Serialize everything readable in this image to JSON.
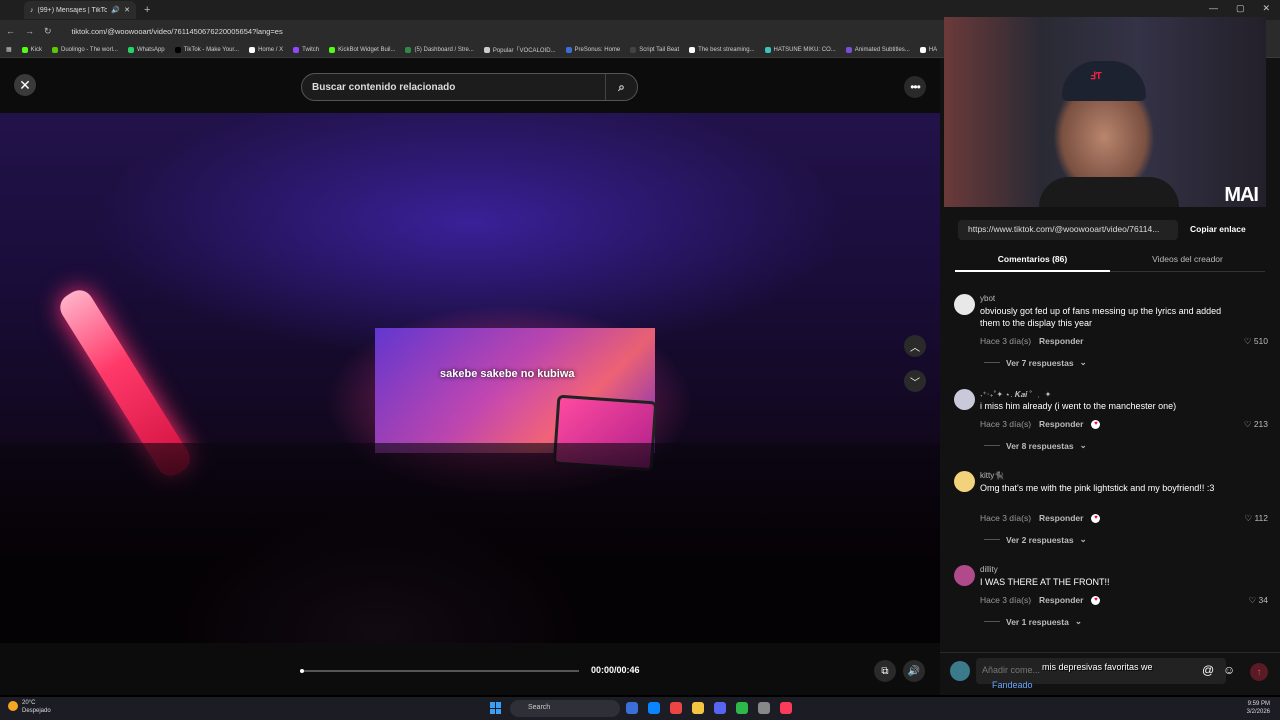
{
  "browser": {
    "tab_title": "(99+) Mensajes | TikTok",
    "address": "tiktok.com/@woowooart/video/7611450676220005654?lang=es",
    "bookmarks": [
      {
        "label": "Kick",
        "color": "#53fc18"
      },
      {
        "label": "Duolingo - The worl...",
        "color": "#58cc02"
      },
      {
        "label": "WhatsApp",
        "color": "#25d366"
      },
      {
        "label": "TikTok - Make Your...",
        "color": "#000000"
      },
      {
        "label": "Home / X",
        "color": "#ffffff"
      },
      {
        "label": "Twitch",
        "color": "#9146ff"
      },
      {
        "label": "KickBot Widget Buil...",
        "color": "#53fc18"
      },
      {
        "label": "(5) Dashboard / Stre...",
        "color": "#2f8a4a"
      },
      {
        "label": "Popular「VOCALOID...",
        "color": "#cccccc"
      },
      {
        "label": "PreSonus: Home",
        "color": "#3a6fd8"
      },
      {
        "label": "Script Tail Beat",
        "color": "#444444"
      },
      {
        "label": "The best streaming...",
        "color": "#ffffff"
      },
      {
        "label": "HATSUNE MIKU: CO...",
        "color": "#39c5bb"
      },
      {
        "label": "Animated Subtitles...",
        "color": "#7a4fd8"
      },
      {
        "label": "HA",
        "color": "#ffffff"
      }
    ]
  },
  "player": {
    "search_placeholder": "Buscar contenido relacionado",
    "overlay_text": "sakebe sakebe no kubiwa",
    "time": "00:00/00:46",
    "progress": 0.0
  },
  "panel": {
    "link": "https://www.tiktok.com/@woowooart/video/76114...",
    "copy_label": "Copiar enlace",
    "tab_comments": "Comentarios (86)",
    "tab_creator": "Videos del creador",
    "webcam_overlay": "MAI",
    "comments": [
      {
        "user": "ybot",
        "text": "obviously got fed up of fans messing up the lyrics and added them to the display this year",
        "time": "Hace 3 día(s)",
        "reply": "Responder",
        "likes": "510",
        "replies": "Ver 7 respuestas",
        "avatar": "#e8e8e8"
      },
      {
        "user": "˖⁺‧₊˚✦ ⋆. 𝑲𝒂𝒊 ˚ ﹒ ✦",
        "text": "i miss him already (i went to the manchester one)",
        "time": "Hace 3 día(s)",
        "reply": "Responder",
        "likes": "213",
        "replies": "Ver 8 respuestas",
        "avatar": "#c9c9d9"
      },
      {
        "user": "kitty🐈‍⬛",
        "text": "Omg that's me with the pink lightstick and my boyfriend!! :3",
        "time": "Hace 3 día(s)",
        "reply": "Responder",
        "likes": "112",
        "replies": "Ver 2 respuestas",
        "avatar": "#f2d27a"
      },
      {
        "user": "dillity",
        "text": "I WAS THERE AT THE FRONT!!",
        "time": "Hace 3 día(s)",
        "reply": "Responder",
        "likes": "34",
        "replies": "Ver 1 respuesta",
        "avatar": "#b04a8a"
      }
    ],
    "input_placeholder": "Añadir come...",
    "chat_line1": "mis depresivas favoritas we",
    "chat_line2": "Fandeado"
  },
  "taskbar": {
    "temp": "20°C",
    "weather": "Despejado",
    "search": "Search",
    "time": "9:59 PM",
    "date": "3/2/2026"
  }
}
